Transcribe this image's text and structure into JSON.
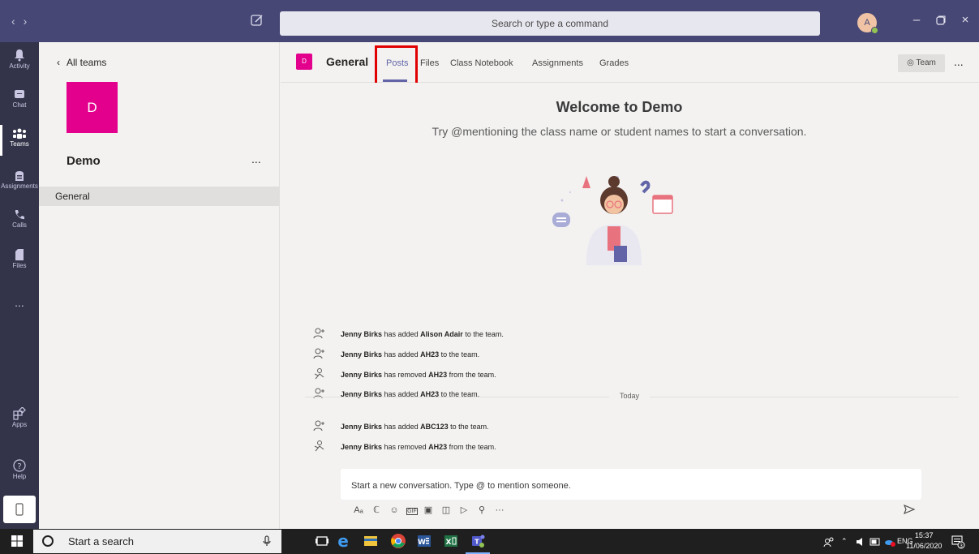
{
  "titlebar": {
    "search_placeholder": "Search or type a command",
    "avatar_initial": "A"
  },
  "appbar": {
    "items": [
      {
        "label": "Activity",
        "icon": "bell-icon"
      },
      {
        "label": "Chat",
        "icon": "chat-icon"
      },
      {
        "label": "Teams",
        "icon": "teams-icon"
      },
      {
        "label": "Assignments",
        "icon": "assignments-icon"
      },
      {
        "label": "Calls",
        "icon": "phone-icon"
      },
      {
        "label": "Files",
        "icon": "file-icon"
      },
      {
        "label": "Apps",
        "icon": "apps-icon"
      },
      {
        "label": "Help",
        "icon": "help-icon"
      }
    ],
    "more": "..."
  },
  "leftpanel": {
    "back_label": "All teams",
    "team_initial": "D",
    "team_name": "Demo",
    "more": "...",
    "channels": [
      {
        "label": "General"
      }
    ]
  },
  "channel": {
    "badge": "D",
    "title": "General",
    "tabs": [
      {
        "label": "Posts"
      },
      {
        "label": "Files"
      },
      {
        "label": "Class Notebook"
      },
      {
        "label": "Assignments"
      },
      {
        "label": "Grades"
      }
    ],
    "team_button": "Team",
    "more": "..."
  },
  "main": {
    "welcome_title": "Welcome to Demo",
    "welcome_sub": "Try @mentioning the class name or student names to start a conversation.",
    "activities": [
      {
        "actor": "Jenny Birks",
        "action": "has added",
        "target": "Alison Adair",
        "suffix": "to the team.",
        "icon": "add-person-icon"
      },
      {
        "actor": "Jenny Birks",
        "action": "has added",
        "target": "AH23",
        "suffix": "to the team.",
        "icon": "add-person-icon"
      },
      {
        "actor": "Jenny Birks",
        "action": "has removed",
        "target": "AH23",
        "suffix": "from the team.",
        "icon": "remove-person-icon"
      },
      {
        "actor": "Jenny Birks",
        "action": "has added",
        "target": "AH23",
        "suffix": "to the team.",
        "icon": "add-person-icon"
      },
      {
        "actor": "Jenny Birks",
        "action": "has added",
        "target": "ABC123",
        "suffix": "to the team.",
        "icon": "add-person-icon"
      },
      {
        "actor": "Jenny Birks",
        "action": "has removed",
        "target": "AH23",
        "suffix": "from the team.",
        "icon": "remove-person-icon"
      }
    ],
    "today_label": "Today",
    "compose_placeholder": "Start a new conversation. Type @ to mention someone.",
    "compose_more": "···"
  },
  "taskbar": {
    "search_placeholder": "Start a search",
    "language": "ENG",
    "time": "15:37",
    "date": "11/06/2020",
    "notification_count": "3"
  },
  "colors": {
    "titlebar": "#464775",
    "appbar": "#33344a",
    "accent": "#6264a7",
    "team": "#e3008c",
    "highlight": "#e00000"
  }
}
